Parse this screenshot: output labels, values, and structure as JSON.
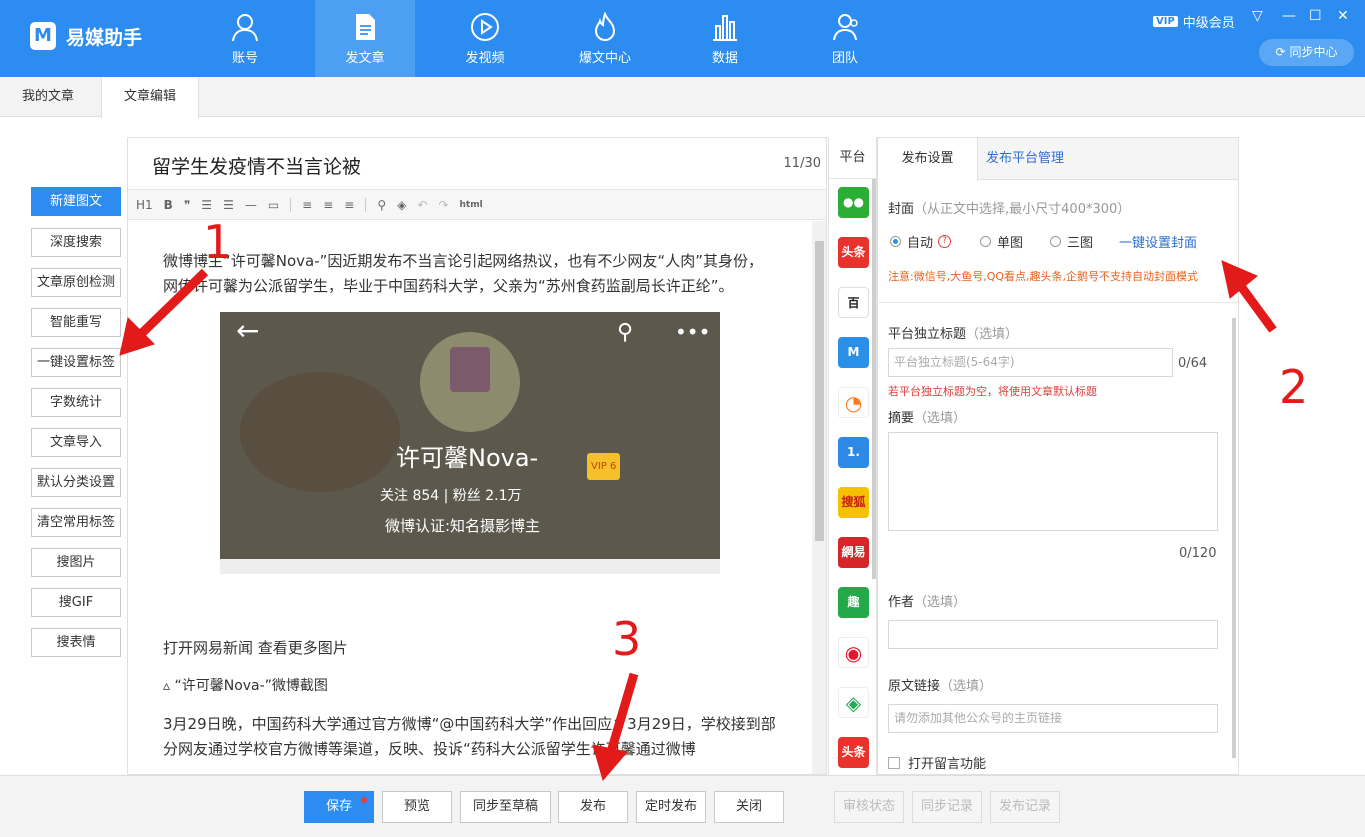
{
  "app": {
    "name": "易媒助手",
    "logo_letter": "M",
    "vip_badge": "VIP",
    "vip_level": "中级会员",
    "sync_label": "同步中心"
  },
  "nav": [
    {
      "label": "账号",
      "icon": "user-icon"
    },
    {
      "label": "发文章",
      "icon": "document-icon"
    },
    {
      "label": "发视频",
      "icon": "play-icon"
    },
    {
      "label": "爆文中心",
      "icon": "flame-icon"
    },
    {
      "label": "数据",
      "icon": "bar-chart-icon"
    },
    {
      "label": "团队",
      "icon": "team-icon"
    }
  ],
  "nav_active": "发文章",
  "tabs": [
    "我的文章",
    "文章编辑"
  ],
  "left_buttons": [
    "新建图文",
    "深度搜索",
    "文章原创检测",
    "智能重写",
    "一键设置标签",
    "字数统计",
    "文章导入",
    "默认分类设置",
    "清空常用标签",
    "搜图片",
    "搜GIF",
    "搜表情"
  ],
  "editor": {
    "title": "留学生发疫情不当言论被",
    "title_count": "11/30",
    "toolbar_html": "html",
    "para1": "微博博主“许可馨Nova-”因近期发布不当言论引起网络热议，也有不少网友“人肉”其身份，网传许可馨为公派留学生，毕业于中国药科大学，父亲为“苏州食药监副局长许正纶”。",
    "image": {
      "name": "许可馨Nova-",
      "vip": "VIP 6",
      "follow": "关注  854   |   粉丝  2.1万",
      "verified": "微博认证:知名摄影博主"
    },
    "para2": "打开网易新闻 查看更多图片",
    "para3": "▵ “许可馨Nova-”微博截图",
    "para4": "3月29日晚，中国药科大学通过官方微博“@中国药科大学”作出回应：3月29日，学校接到部分网友通过学校官方微博等渠道，反映、投诉“药科大公派留学生许可馨通过微博"
  },
  "platform": {
    "header": "平台",
    "icons": [
      {
        "name": "wechat-icon",
        "text": "",
        "color": "#2aae35"
      },
      {
        "name": "toutiao-icon",
        "text": "头条",
        "color": "#e8322b"
      },
      {
        "name": "baijia-icon",
        "text": "百",
        "color": "#ffffff"
      },
      {
        "name": "dayu-icon",
        "text": "",
        "color": "#2a8fe6"
      },
      {
        "name": "qq-kandian-icon",
        "text": "",
        "color": "#ff7a1f"
      },
      {
        "name": "yidian-icon",
        "text": "1.",
        "color": "#2e88e6"
      },
      {
        "name": "sohu-icon",
        "text": "搜狐",
        "color": "#f5c100"
      },
      {
        "name": "netease-icon",
        "text": "網易",
        "color": "#d6262a"
      },
      {
        "name": "qutoutiao-icon",
        "text": "趣",
        "color": "#22a94a"
      },
      {
        "name": "weibo-icon",
        "text": "",
        "color": "#e6162d"
      },
      {
        "name": "penguin-icon",
        "text": "",
        "color": "#24a954"
      },
      {
        "name": "toutiao2-icon",
        "text": "头条",
        "color": "#e8322b"
      }
    ]
  },
  "settings": {
    "tab_active": "发布设置",
    "tab_link": "发布平台管理",
    "cover_label": "封面",
    "cover_hint": "（从正文中选择,最小尺寸400*300）",
    "radio_auto": "自动",
    "radio_single": "单图",
    "radio_triple": "三图",
    "cover_link": "一键设置封面",
    "cover_note": "注意:微信号,大鱼号,QQ看点,趣头条,企鹅号不支持自动封面模式",
    "title_label": "平台独立标题",
    "optional": "（选填）",
    "title_placeholder": "平台独立标题(5-64字)",
    "title_count": "0/64",
    "title_note": "若平台独立标题为空，将使用文章默认标题",
    "summary_label": "摘要",
    "summary_count": "0/120",
    "author_label": "作者",
    "link_label": "原文链接",
    "link_placeholder": "请勿添加其他公众号的主页链接",
    "comment_label": "打开留言功能"
  },
  "bottom": {
    "save": "保存",
    "preview": "预览",
    "sync_draft": "同步至草稿",
    "publish": "发布",
    "schedule": "定时发布",
    "close": "关闭",
    "review": "审核状态",
    "sync_log": "同步记录",
    "publish_log": "发布记录"
  },
  "annotations": {
    "n1": "1",
    "n2": "2",
    "n3": "3",
    "color": "#e21a1a"
  }
}
